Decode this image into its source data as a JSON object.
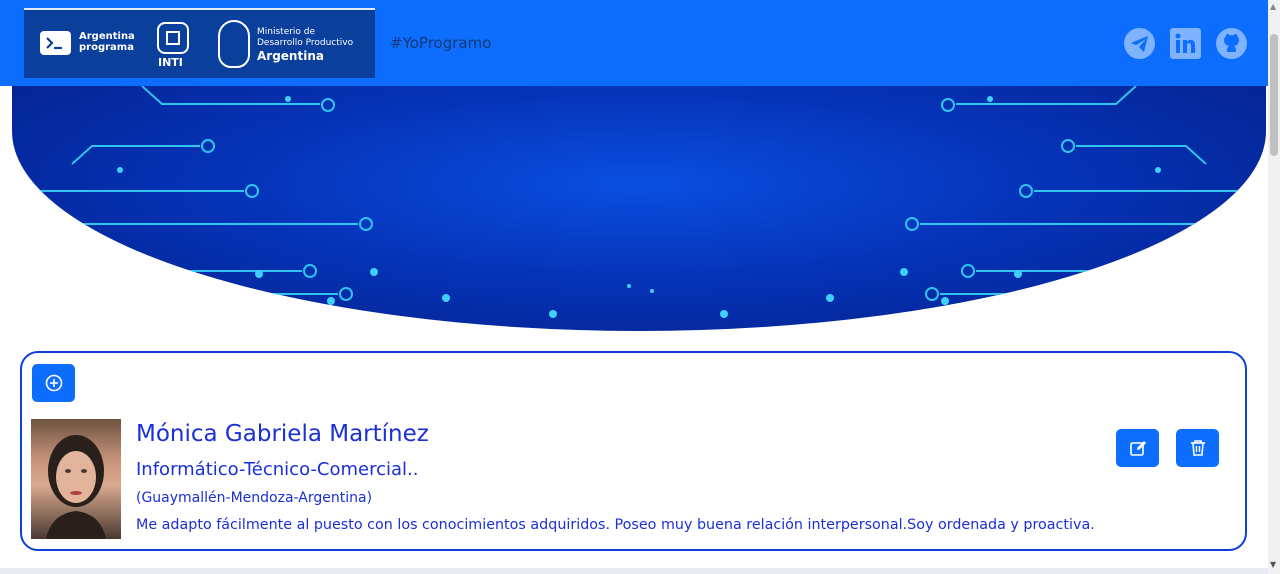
{
  "header": {
    "brand_ap_line1": "Argentina",
    "brand_ap_line2": "programa",
    "brand_inti": "INTI",
    "brand_min_line1": "Ministerio de",
    "brand_min_line2": "Desarrollo Productivo",
    "brand_min_line3": "Argentina",
    "hashtag": "#YoProgramo",
    "social_icons": [
      "telegram-icon",
      "linkedin-icon",
      "github-icon"
    ]
  },
  "profile": {
    "name": "Mónica Gabriela Martínez",
    "title": "Informático-Técnico-Comercial..",
    "location": "(Guaymallén-Mendoza-Argentina)",
    "about": "Me adapto fácilmente al puesto con los conocimientos adquiridos. Poseo muy buena relación interpersonal.Soy ordenada y proactiva."
  },
  "colors": {
    "navbar": "#0d6efd",
    "accent_text": "#1a2fd6",
    "banner_dark": "#041f86"
  }
}
